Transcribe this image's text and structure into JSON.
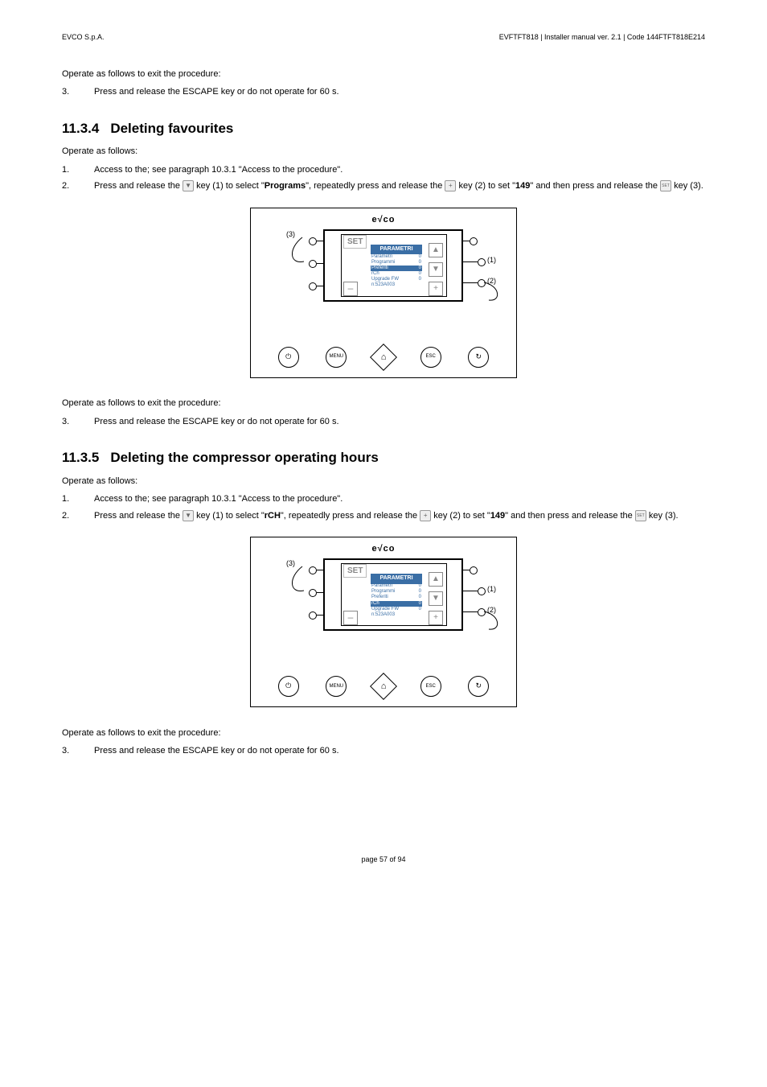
{
  "header": {
    "company": "EVCO S.p.A.",
    "docinfo": "EVFTFT818 | Installer manual ver. 2.1 | Code 144FTFT818E214"
  },
  "common": {
    "exit_intro": "Operate as follows to exit the procedure:",
    "exit_step_num": "3.",
    "exit_step_text": "Press and release the ESCAPE key or do not operate for 60 s.",
    "operate": "Operate as follows:",
    "step1_num": "1.",
    "step1_text": "Access to the; see paragraph 10.3.1 \"Access to the procedure\".",
    "step2_num": "2."
  },
  "sec4": {
    "num": "11.3.4",
    "title": "Deleting favourites",
    "step2_a": "Press and release the ",
    "step2_b": " key (1) to select \"",
    "step2_target": "Programs",
    "step2_c": "\", repeatedly press and release the ",
    "step2_d": " key (2) to set \"",
    "step2_val": "149",
    "step2_e": "\" and then press and release the ",
    "step2_f": " key (3)."
  },
  "sec5": {
    "num": "11.3.5",
    "title": "Deleting the compressor operating hours",
    "step2_a": "Press and release the ",
    "step2_b": " key (1) to select \"",
    "step2_target": "rCH",
    "step2_c": "\", repeatedly press and release the ",
    "step2_d": " key (2) to set \"",
    "step2_val": "149",
    "step2_e": "\" and then press and release the ",
    "step2_f": " key (3)."
  },
  "figure": {
    "logo": "e√co",
    "set": "SET",
    "header": "PARAMETRI",
    "rows": {
      "r1": "Parametri",
      "r2": "Programmi",
      "r3": "Preferiti",
      "r4": "rCh",
      "r5": "Upgrade FW",
      "r6": "n:523A003"
    },
    "zero": "0",
    "up": "▲",
    "down": "▼",
    "plus": "+",
    "minus": "–",
    "callouts": {
      "c1": "(1)",
      "c2": "(2)",
      "c3": "(3)"
    },
    "bottom": {
      "menu": "MENU",
      "esc": "ESC",
      "power": "⏻",
      "home": "⌂",
      "cycle": "↻"
    }
  },
  "figure_b_hl_row": "rCh",
  "footer": "page 57 of 94"
}
